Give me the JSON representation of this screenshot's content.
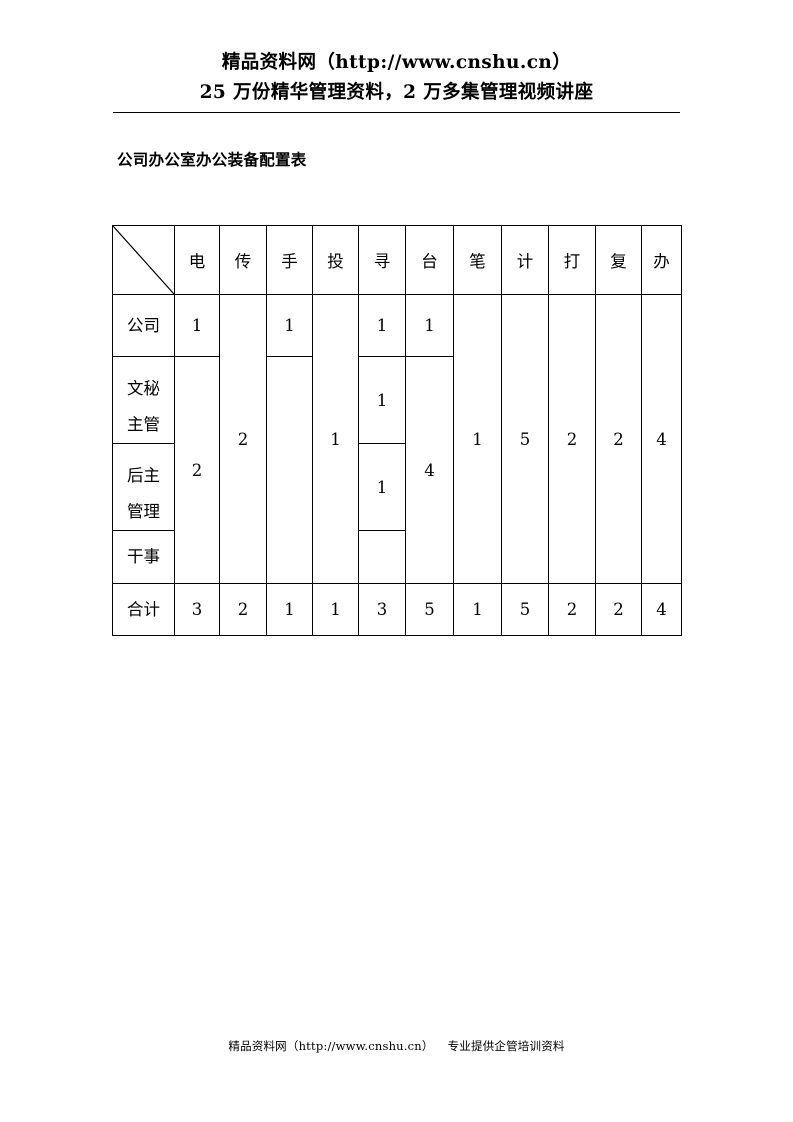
{
  "header": {
    "line1": "精品资料网（http://www.cnshu.cn）",
    "line2": "25 万份精华管理资料，2 万多集管理视频讲座"
  },
  "title": "公司办公室办公装备配置表",
  "table": {
    "corner_label": "",
    "column_headers": [
      "电",
      "传",
      "手",
      "投",
      "寻",
      "台",
      "笔",
      "计",
      "打",
      "复",
      "办"
    ],
    "row_labels": [
      "公司",
      "文秘",
      "主管",
      "后主",
      "管理",
      "干事",
      "合计"
    ],
    "rows": [
      {
        "label": "公司",
        "cells": [
          "1",
          "2",
          "1",
          "1",
          "1",
          "1",
          "1",
          "5",
          "2",
          "2",
          "4"
        ]
      },
      {
        "label": "文秘",
        "label_overflow": "主管",
        "cells": [
          "2",
          "",
          "",
          "",
          "1",
          "4",
          "",
          "",
          "",
          "",
          ""
        ]
      },
      {
        "label": "后主",
        "label_overflow": "管理",
        "cells": [
          "",
          "",
          "",
          "",
          "1",
          "",
          "",
          "",
          "",
          "",
          ""
        ]
      },
      {
        "label": "干事",
        "cells": [
          "",
          "",
          "",
          "",
          "",
          "",
          "",
          "",
          "",
          "",
          ""
        ]
      }
    ],
    "total_row": {
      "label": "合计",
      "cells": [
        "3",
        "2",
        "1",
        "1",
        "3",
        "5",
        "1",
        "5",
        "2",
        "2",
        "4"
      ]
    },
    "merged_values": {
      "dian_row1": "1",
      "dian_rows234": "2",
      "chuan_all": "2",
      "shou_row1": "1",
      "tou_all": "1",
      "xun_row1": "1",
      "xun_row2": "1",
      "xun_row3": "1",
      "tai_row1": "1",
      "tai_rows234": "4",
      "bi_all": "1",
      "ji_all": "5",
      "da_all": "2",
      "fu_all": "2",
      "ban_all": "4"
    }
  },
  "footer": {
    "site": "精品资料网（http://www.cnshu.cn）",
    "tagline": "专业提供企管培训资料"
  }
}
